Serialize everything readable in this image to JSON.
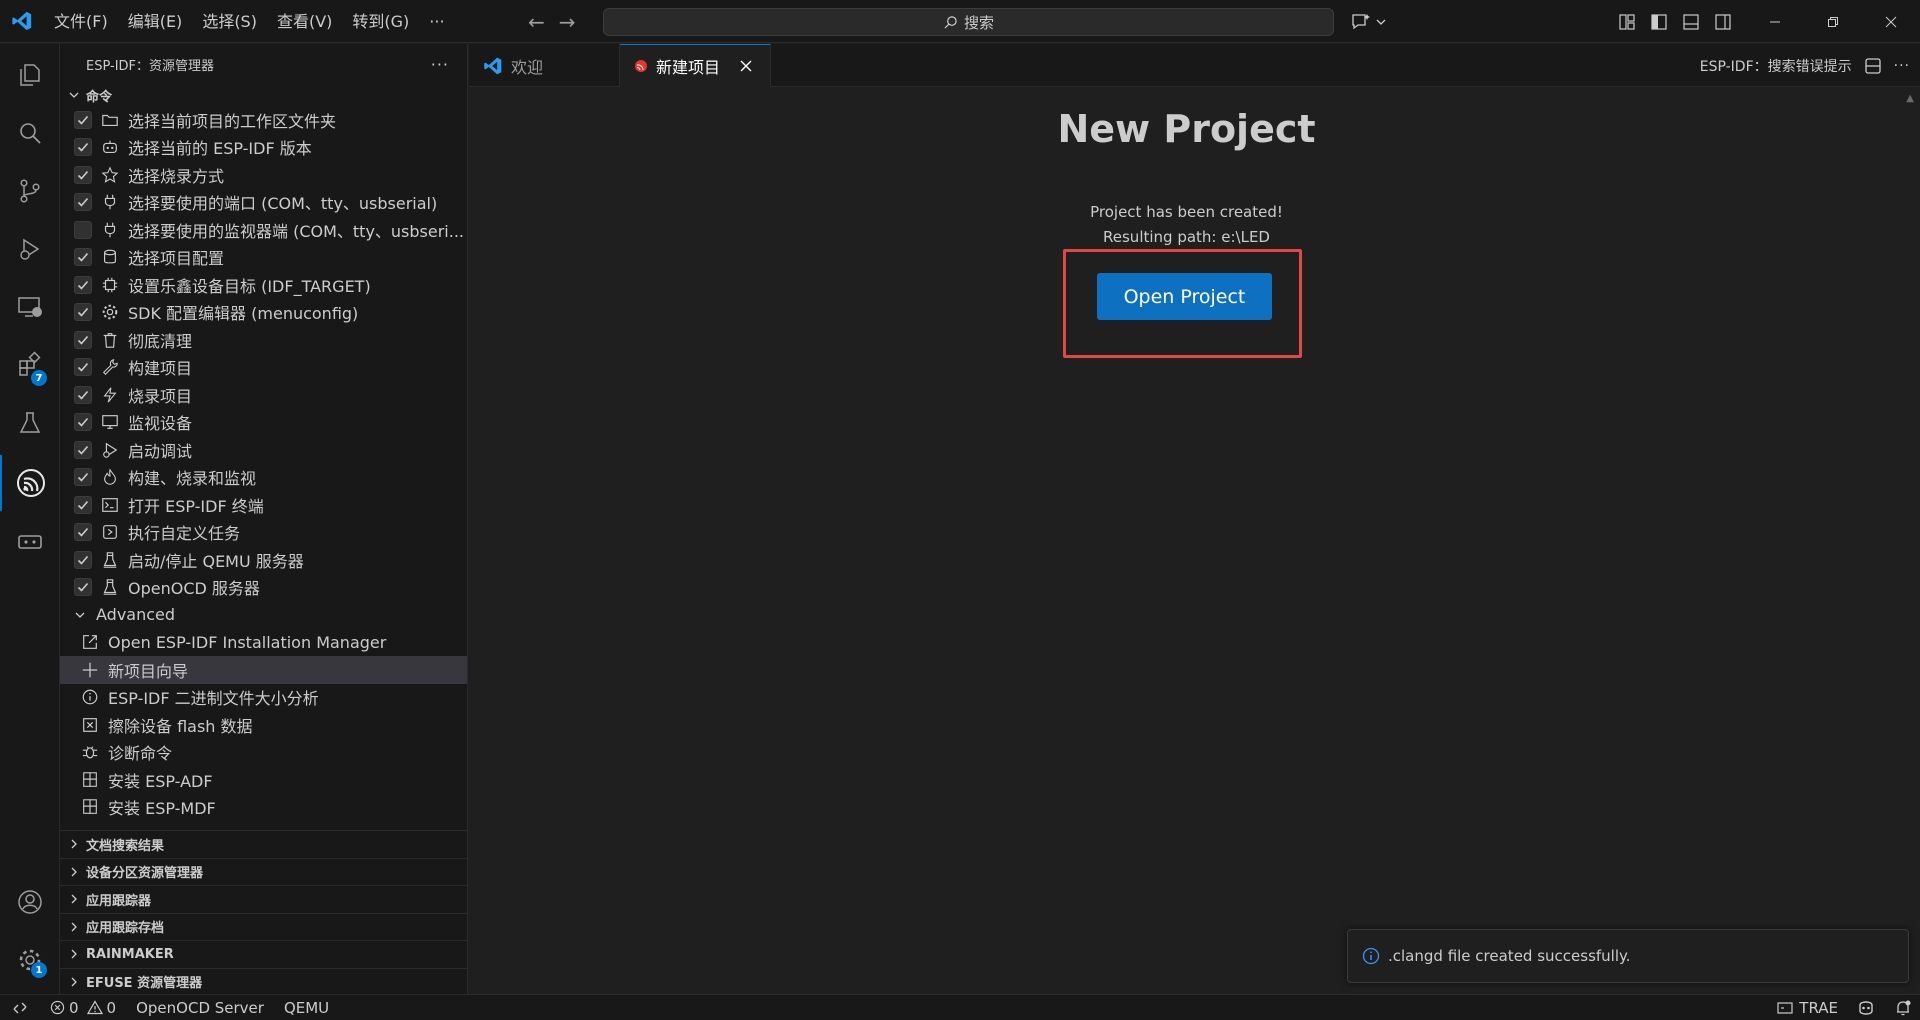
{
  "titlebar": {
    "menu": [
      "文件(F)",
      "编辑(E)",
      "选择(S)",
      "查看(V)",
      "转到(G)",
      "···"
    ],
    "search_placeholder": "搜索"
  },
  "activitybar": {
    "extensions_badge": "7",
    "settings_badge": "1"
  },
  "sidebar": {
    "title": "ESP-IDF：资源管理器",
    "commands_section": "命令",
    "commands": [
      {
        "label": "选择当前项目的工作区文件夹",
        "checked": true,
        "icon": "folder-icon"
      },
      {
        "label": "选择当前的 ESP-IDF 版本",
        "checked": true,
        "icon": "robot-icon"
      },
      {
        "label": "选择烧录方式",
        "checked": true,
        "icon": "star-icon"
      },
      {
        "label": "选择要使用的端口 (COM、tty、usbserial)",
        "checked": true,
        "icon": "plug-icon"
      },
      {
        "label": "选择要使用的监视器端 (COM、tty、usbseri...",
        "checked": false,
        "icon": "plug-icon"
      },
      {
        "label": "选择项目配置",
        "checked": true,
        "icon": "database-icon"
      },
      {
        "label": "设置乐鑫设备目标 (IDF_TARGET)",
        "checked": true,
        "icon": "chip-icon"
      },
      {
        "label": "SDK 配置编辑器 (menuconfig)",
        "checked": true,
        "icon": "gear-icon"
      },
      {
        "label": "彻底清理",
        "checked": true,
        "icon": "trash-icon"
      },
      {
        "label": "构建项目",
        "checked": true,
        "icon": "wrench-icon"
      },
      {
        "label": "烧录项目",
        "checked": true,
        "icon": "lightning-icon"
      },
      {
        "label": "监视设备",
        "checked": true,
        "icon": "monitor-icon"
      },
      {
        "label": "启动调试",
        "checked": true,
        "icon": "debug-icon"
      },
      {
        "label": "构建、烧录和监视",
        "checked": true,
        "icon": "flame-icon"
      },
      {
        "label": "打开 ESP-IDF 终端",
        "checked": true,
        "icon": "terminal-icon"
      },
      {
        "label": "执行自定义任务",
        "checked": true,
        "icon": "run-task-icon"
      },
      {
        "label": "启动/停止 QEMU 服务器",
        "checked": true,
        "icon": "server-icon"
      },
      {
        "label": "OpenOCD 服务器",
        "checked": true,
        "icon": "server-icon"
      }
    ],
    "advanced_label": "Advanced",
    "advanced": [
      {
        "label": "Open ESP-IDF Installation Manager",
        "icon": "external-link-icon"
      },
      {
        "label": "新项目向导",
        "icon": "plus-icon",
        "selected": true
      },
      {
        "label": "ESP-IDF 二进制文件大小分析",
        "icon": "info-icon"
      },
      {
        "label": "擦除设备 flash 数据",
        "icon": "erase-icon"
      },
      {
        "label": "诊断命令",
        "icon": "bug-icon"
      },
      {
        "label": "安装 ESP-ADF",
        "icon": "package-icon"
      },
      {
        "label": "安装 ESP-MDF",
        "icon": "package-icon"
      }
    ],
    "collapsed_sections": [
      "文档搜索结果",
      "设备分区资源管理器",
      "应用跟踪器",
      "应用跟踪存档",
      "RAINMAKER",
      "EFUSE 资源管理器"
    ]
  },
  "tabs": [
    {
      "label": "欢迎",
      "active": false
    },
    {
      "label": "新建项目",
      "active": true
    }
  ],
  "tab_right_label": "ESP-IDF：搜索错误提示",
  "editor": {
    "title": "New Project",
    "message_line1": "Project has been created!",
    "message_line2": "Resulting path: e:\\LED",
    "open_button": "Open Project"
  },
  "notification": {
    "text": ".clangd file created successfully."
  },
  "statusbar": {
    "errors": "0",
    "warnings": "0",
    "openocd": "OpenOCD Server",
    "qemu": "QEMU",
    "trae": "TRAE"
  },
  "colors": {
    "accent": "#0078d4",
    "button": "#0e70c0",
    "highlight": "#e04848"
  }
}
